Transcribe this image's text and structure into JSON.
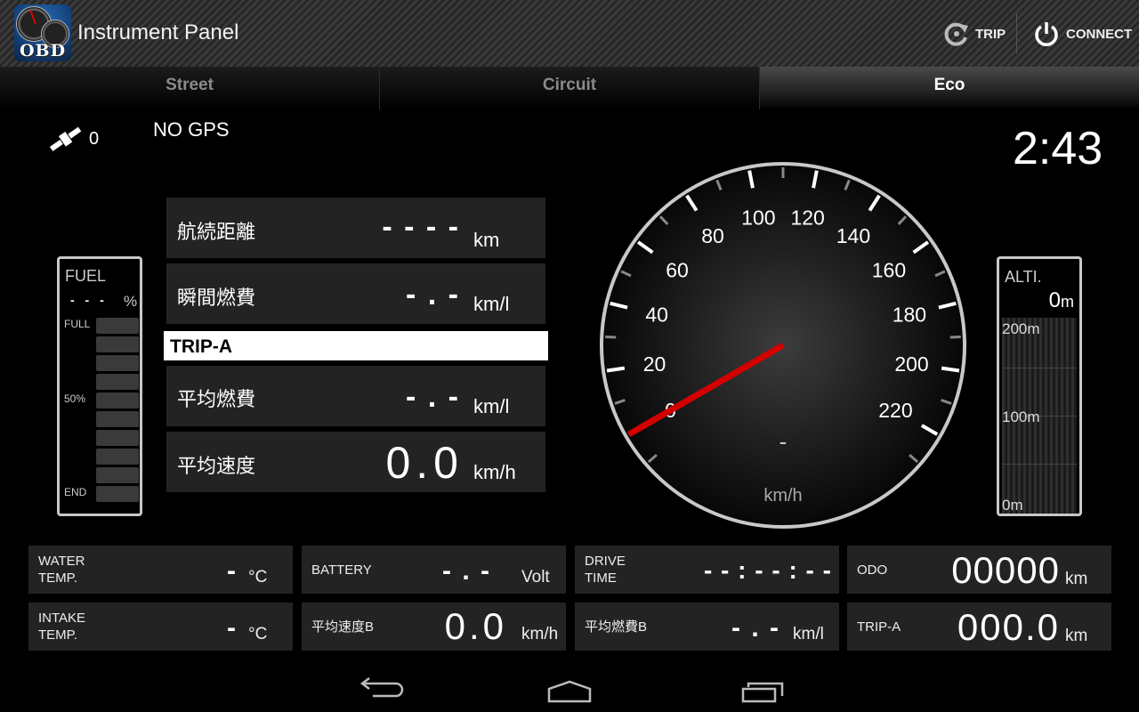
{
  "app": {
    "title": "Instrument Panel",
    "icon_label": "OBD"
  },
  "actions": {
    "trip": "TRIP",
    "connect": "CONNECT"
  },
  "tabs": [
    {
      "label": "Street",
      "active": false
    },
    {
      "label": "Circuit",
      "active": false
    },
    {
      "label": "Eco",
      "active": true
    }
  ],
  "gps": {
    "satellites": "0",
    "status": "NO GPS"
  },
  "clock": "2:43",
  "fuel": {
    "label": "FUEL",
    "value": "- - -",
    "unit": "%",
    "marks": {
      "full": "FULL",
      "half": "50%",
      "end": "END"
    },
    "segments": 10,
    "level_percent": null
  },
  "info": [
    {
      "label": "航続距離",
      "value": "- - - -",
      "unit": "km"
    },
    {
      "label": "瞬間燃費",
      "value": "- . -",
      "unit": "km/l"
    }
  ],
  "trip_section": {
    "title": "TRIP-A",
    "items": [
      {
        "label": "平均燃費",
        "value": "- . -",
        "unit": "km/l"
      },
      {
        "label": "平均速度",
        "value": "0.0",
        "unit": "km/h"
      }
    ]
  },
  "speedometer": {
    "unit": "km/h",
    "digital_value": "-",
    "min": 0,
    "max": 220,
    "major_step": 20,
    "tick_labels": [
      "0",
      "20",
      "40",
      "60",
      "80",
      "100",
      "120",
      "140",
      "160",
      "180",
      "200",
      "220"
    ],
    "needle_value": 0,
    "needle_color": "#d40000"
  },
  "altitude": {
    "label": "ALTI.",
    "value": "0",
    "unit": "m",
    "marks": [
      "200m",
      "100m",
      "0m"
    ]
  },
  "bottom": [
    {
      "label": "WATER\nTEMP.",
      "value": "-",
      "unit": "°C"
    },
    {
      "label": "BATTERY",
      "value": "- . -",
      "unit": "Volt"
    },
    {
      "label": "DRIVE\nTIME",
      "value": "- - : - - : - -",
      "unit": ""
    },
    {
      "label": "ODO",
      "value": "00000",
      "unit": "km"
    },
    {
      "label": "INTAKE\nTEMP.",
      "value": "-",
      "unit": "°C"
    },
    {
      "label": "平均速度B",
      "value": "0.0",
      "unit": "km/h"
    },
    {
      "label": "平均燃費B",
      "value": "- . -",
      "unit": "km/l"
    },
    {
      "label": "TRIP-A",
      "value": "000.0",
      "unit": "km"
    }
  ],
  "nav": {
    "back": "back",
    "home": "home",
    "recents": "recents"
  }
}
